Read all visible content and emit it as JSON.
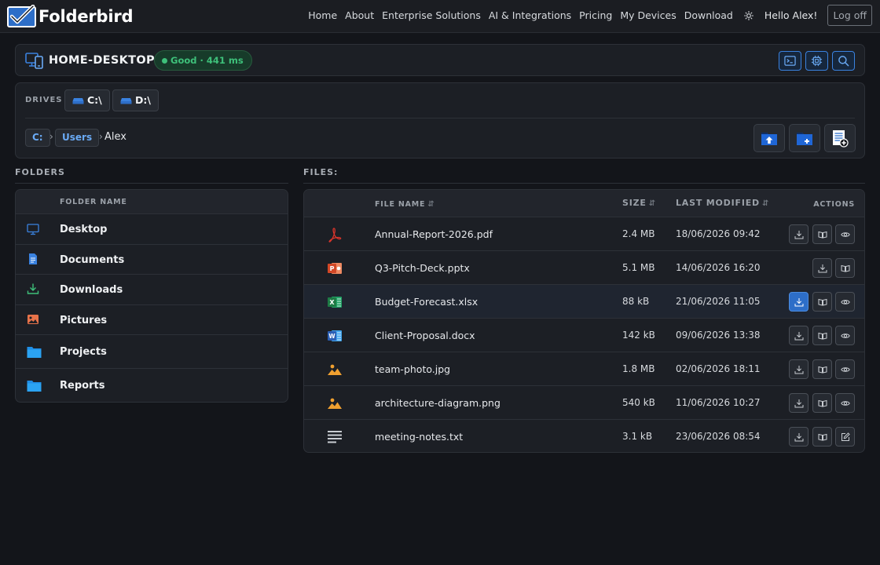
{
  "nav": {
    "brand": "Folderbird",
    "links": [
      "Home",
      "About",
      "Enterprise Solutions",
      "AI & Integrations",
      "Pricing",
      "My Devices",
      "Download"
    ],
    "greeting": "Hello Alex!",
    "logoff": "Log off"
  },
  "device": {
    "name": "HOME-DESKTOP",
    "status": "Good · 441 ms",
    "status_color": "#3ec07a",
    "tools": [
      "terminal-icon",
      "cpu-icon",
      "search-icon"
    ]
  },
  "drives": {
    "label": "DRIVES",
    "items": [
      "C:\\",
      "D:\\"
    ]
  },
  "path": {
    "root": "C:",
    "parent": "Users",
    "current": "Alex",
    "actions": [
      "upload-folder-icon",
      "new-folder-icon",
      "new-file-icon"
    ]
  },
  "folders": {
    "title": "FOLDERS",
    "column": "FOLDER NAME",
    "items": [
      {
        "name": "Desktop",
        "icon": "monitor-icon"
      },
      {
        "name": "Documents",
        "icon": "document-icon"
      },
      {
        "name": "Downloads",
        "icon": "download-icon"
      },
      {
        "name": "Pictures",
        "icon": "picture-icon"
      },
      {
        "name": "Projects",
        "icon": "folder-icon"
      },
      {
        "name": "Reports",
        "icon": "folder-icon"
      }
    ]
  },
  "files": {
    "title": "FILES:",
    "columns": {
      "name": "FILE NAME",
      "size": "SIZE",
      "modified": "LAST MODIFIED",
      "actions": "ACTIONS"
    },
    "rows": [
      {
        "name": "Annual-Report-2026.pdf",
        "size": "2.4 MB",
        "modified": "18/06/2026 09:42",
        "type": "pdf",
        "actions": [
          "download",
          "open",
          "preview"
        ]
      },
      {
        "name": "Q3-Pitch-Deck.pptx",
        "size": "5.1 MB",
        "modified": "14/06/2026 16:20",
        "type": "pptx",
        "actions": [
          "download",
          "open"
        ]
      },
      {
        "name": "Budget-Forecast.xlsx",
        "size": "88 kB",
        "modified": "21/06/2026 11:05",
        "type": "xlsx",
        "actions": [
          "download",
          "open",
          "preview"
        ],
        "highlighted": true
      },
      {
        "name": "Client-Proposal.docx",
        "size": "142 kB",
        "modified": "09/06/2026 13:38",
        "type": "docx",
        "actions": [
          "download",
          "open",
          "preview"
        ]
      },
      {
        "name": "team-photo.jpg",
        "size": "1.8 MB",
        "modified": "02/06/2026 18:11",
        "type": "image",
        "actions": [
          "download",
          "open",
          "preview"
        ]
      },
      {
        "name": "architecture-diagram.png",
        "size": "540 kB",
        "modified": "11/06/2026 10:27",
        "type": "image",
        "actions": [
          "download",
          "open",
          "preview"
        ]
      },
      {
        "name": "meeting-notes.txt",
        "size": "3.1 kB",
        "modified": "23/06/2026 08:54",
        "type": "text",
        "actions": [
          "download",
          "open",
          "edit"
        ]
      }
    ]
  },
  "colors": {
    "accent": "#3a82e0",
    "background": "#13151a",
    "card": "#1c1f25",
    "pdf": "#d9342b",
    "pptx": "#d24726",
    "xlsx": "#1e7a45",
    "docx": "#2b5fb4",
    "image": "#f0a030"
  }
}
